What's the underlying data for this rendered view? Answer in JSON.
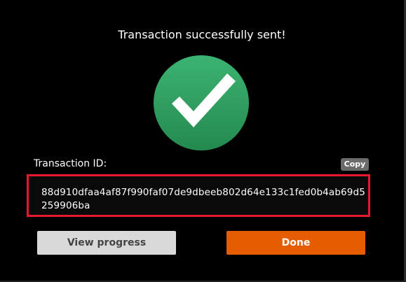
{
  "dialog": {
    "title": "Transaction successfully sent!",
    "status_icon": "checkmark-circle-icon",
    "txid_label": "Transaction ID:",
    "copy_label": "Copy",
    "txid": "88d910dfaa4af87f990faf07de9dbeeb802d64e133c1fed0b4ab69d5259906ba",
    "view_progress_label": "View progress",
    "done_label": "Done"
  },
  "colors": {
    "background": "#000000",
    "success_green": "#2e9e5e",
    "highlight_red": "#e8192c",
    "done_orange": "#e65c00",
    "secondary_button": "#d9d9d9",
    "copy_button": "#6b6b6b"
  }
}
